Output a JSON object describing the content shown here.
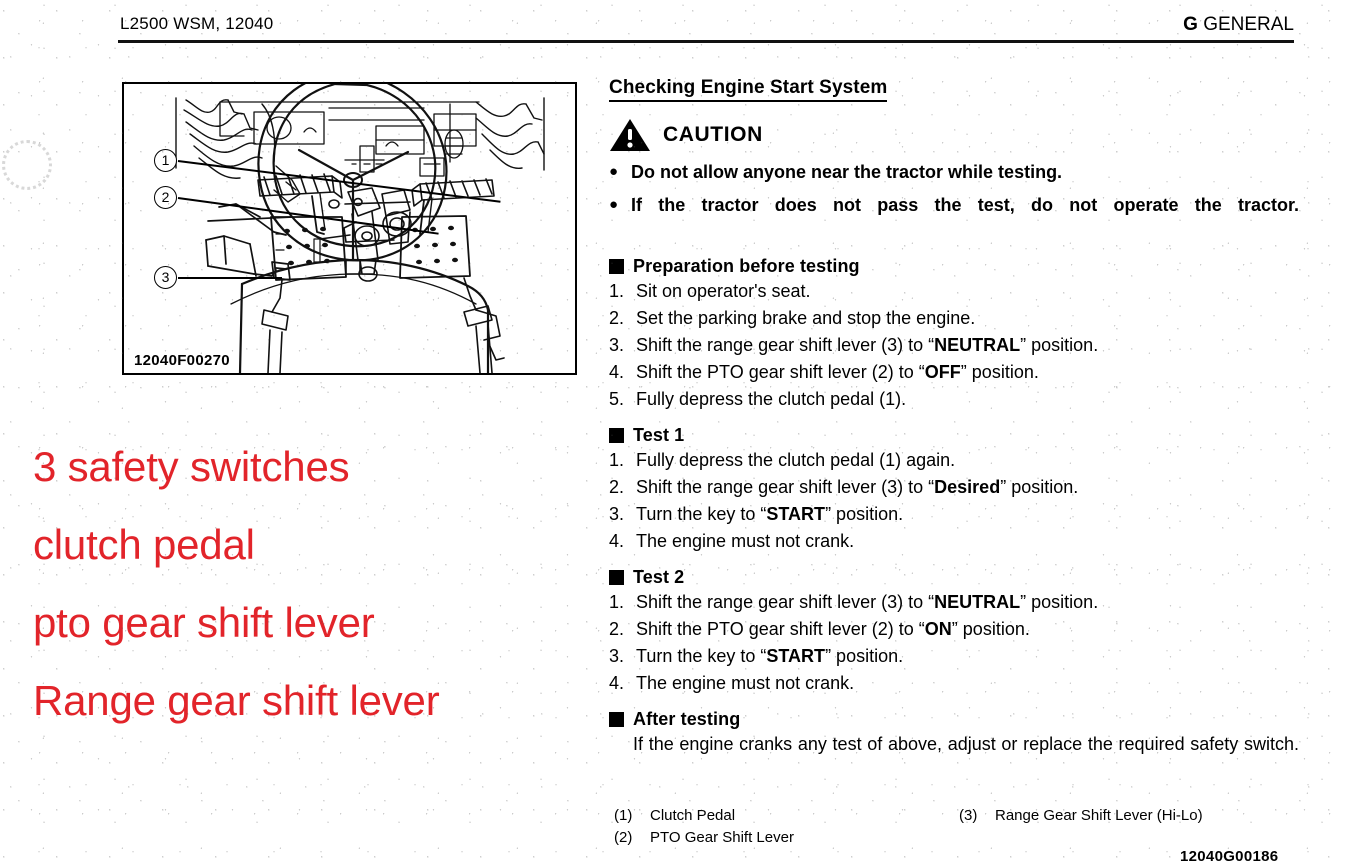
{
  "header": {
    "left": "L2500 WSM, 12040",
    "right_letter": "G",
    "right_label": "GENERAL"
  },
  "figure": {
    "code": "12040F00270",
    "callouts": [
      "1",
      "2",
      "3"
    ],
    "alt": "Tractor operator platform showing clutch pedal, PTO gear shift lever and range gear shift lever"
  },
  "annotations": {
    "color": "#e2242a",
    "lines": [
      "3 safety switches",
      "clutch pedal",
      "pto gear shift lever",
      "Range gear shift lever"
    ]
  },
  "content": {
    "section_title": "Checking Engine Start System",
    "caution": {
      "label": "CAUTION",
      "icon": "warning-triangle-icon",
      "bullets": [
        "Do not allow anyone near the tractor while testing.",
        "If the tractor does not pass the test, do not operate the tractor."
      ]
    },
    "sections": [
      {
        "heading": "Preparation before testing",
        "steps": [
          {
            "num": "1.",
            "parts": [
              {
                "t": "Sit on operator's seat.",
                "b": false
              }
            ]
          },
          {
            "num": "2.",
            "parts": [
              {
                "t": "Set the parking brake and stop the engine.",
                "b": false
              }
            ]
          },
          {
            "num": "3.",
            "parts": [
              {
                "t": "Shift the range gear shift lever (3) to “",
                "b": false
              },
              {
                "t": "NEUTRAL",
                "b": true
              },
              {
                "t": "” position.",
                "b": false
              }
            ]
          },
          {
            "num": "4.",
            "parts": [
              {
                "t": "Shift the PTO gear shift lever (2) to “",
                "b": false
              },
              {
                "t": "OFF",
                "b": true
              },
              {
                "t": "” position.",
                "b": false
              }
            ]
          },
          {
            "num": "5.",
            "parts": [
              {
                "t": "Fully depress the clutch pedal (1).",
                "b": false
              }
            ]
          }
        ]
      },
      {
        "heading": "Test 1",
        "steps": [
          {
            "num": "1.",
            "parts": [
              {
                "t": "Fully depress the clutch pedal (1) again.",
                "b": false
              }
            ]
          },
          {
            "num": "2.",
            "parts": [
              {
                "t": "Shift the range gear shift lever (3) to “",
                "b": false
              },
              {
                "t": "Desired",
                "b": true
              },
              {
                "t": "” position.",
                "b": false
              }
            ]
          },
          {
            "num": "3.",
            "parts": [
              {
                "t": "Turn the key to “",
                "b": false
              },
              {
                "t": "START",
                "b": true
              },
              {
                "t": "” position.",
                "b": false
              }
            ]
          },
          {
            "num": "4.",
            "parts": [
              {
                "t": "The engine must not crank.",
                "b": false
              }
            ]
          }
        ]
      },
      {
        "heading": "Test 2",
        "steps": [
          {
            "num": "1.",
            "parts": [
              {
                "t": "Shift the range gear shift lever (3) to “",
                "b": false
              },
              {
                "t": "NEUTRAL",
                "b": true
              },
              {
                "t": "” position.",
                "b": false
              }
            ]
          },
          {
            "num": "2.",
            "parts": [
              {
                "t": "Shift the PTO gear shift lever (2) to “",
                "b": false
              },
              {
                "t": "ON",
                "b": true
              },
              {
                "t": "” position.",
                "b": false
              }
            ]
          },
          {
            "num": "3.",
            "parts": [
              {
                "t": "Turn the key to “",
                "b": false
              },
              {
                "t": "START",
                "b": true
              },
              {
                "t": "” position.",
                "b": false
              }
            ]
          },
          {
            "num": "4.",
            "parts": [
              {
                "t": "The engine must not crank.",
                "b": false
              }
            ]
          }
        ]
      }
    ],
    "after_testing": {
      "heading": "After testing",
      "body": "If the engine cranks any test of above, adjust or replace the required safety switch."
    }
  },
  "legend": [
    {
      "key": "(1)",
      "label": "Clutch Pedal"
    },
    {
      "key": "(3)",
      "label": "Range Gear Shift Lever (Hi-Lo)"
    },
    {
      "key": "(2)",
      "label": "PTO Gear Shift Lever"
    },
    {
      "key": "",
      "label": ""
    }
  ],
  "footer_code": "12040G00186"
}
